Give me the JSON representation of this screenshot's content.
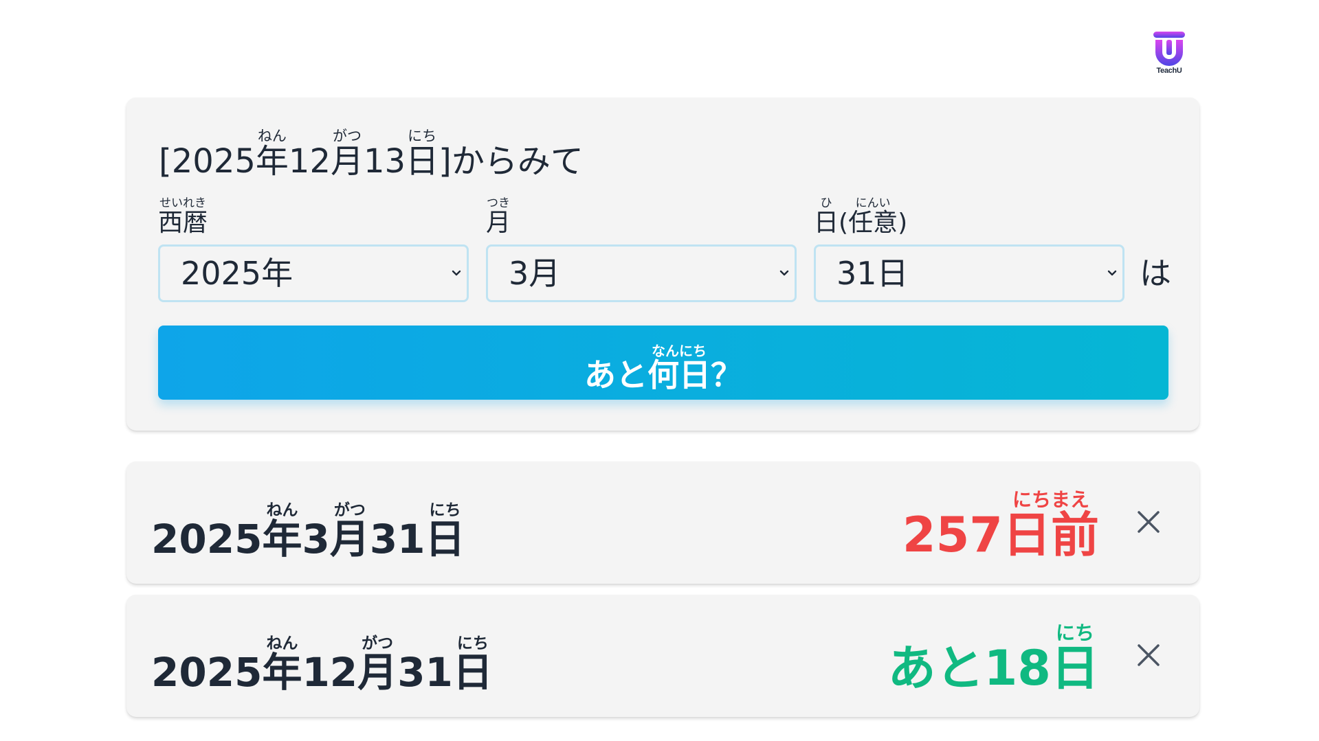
{
  "brand": {
    "logo_text": "TeachU"
  },
  "colors": {
    "past": "#ef4444",
    "future": "#10b981",
    "button_start": "#0ea5e9",
    "button_end": "#06b6d4",
    "select_border": "#bfe3f2",
    "card_bg": "#f4f4f4"
  },
  "form": {
    "heading": {
      "open": "[",
      "year": "2025",
      "year_kanji": "年",
      "year_ruby": "ねん",
      "month": "12",
      "month_kanji": "月",
      "month_ruby": "がつ",
      "day": "13",
      "day_kanji": "日",
      "day_ruby": "にち",
      "close": "]からみて"
    },
    "labels": {
      "year": "西暦",
      "year_ruby": "せいれき",
      "month": "月",
      "month_ruby": "つき",
      "day_kanji": "日",
      "day_ruby": "ひ",
      "day_open": "(",
      "day_optional": "任意",
      "day_optional_ruby": "にんい",
      "day_close": ")"
    },
    "selects": {
      "year": "2025年",
      "month": "3月",
      "day": "31日"
    },
    "suffix": "は",
    "button": {
      "prefix": "あと",
      "kanji": "何日",
      "ruby": "なんにち",
      "suffix": "？"
    },
    "icons": {
      "select_arrow": "chevron-down-icon"
    }
  },
  "results": [
    {
      "year": "2025",
      "year_kanji": "年",
      "year_ruby": "ねん",
      "month": "3",
      "month_kanji": "月",
      "month_ruby": "がつ",
      "day": "31",
      "day_kanji": "日",
      "day_ruby": "にち",
      "diff_prefix": "",
      "diff_number": "257",
      "diff_kanji": "日前",
      "diff_ruby": "にちまえ",
      "status": "past",
      "icon": "close-icon"
    },
    {
      "year": "2025",
      "year_kanji": "年",
      "year_ruby": "ねん",
      "month": "12",
      "month_kanji": "月",
      "month_ruby": "がつ",
      "day": "31",
      "day_kanji": "日",
      "day_ruby": "にち",
      "diff_prefix": "あと",
      "diff_number": "18",
      "diff_kanji": "日",
      "diff_ruby": "にち",
      "status": "future",
      "icon": "close-icon"
    }
  ]
}
